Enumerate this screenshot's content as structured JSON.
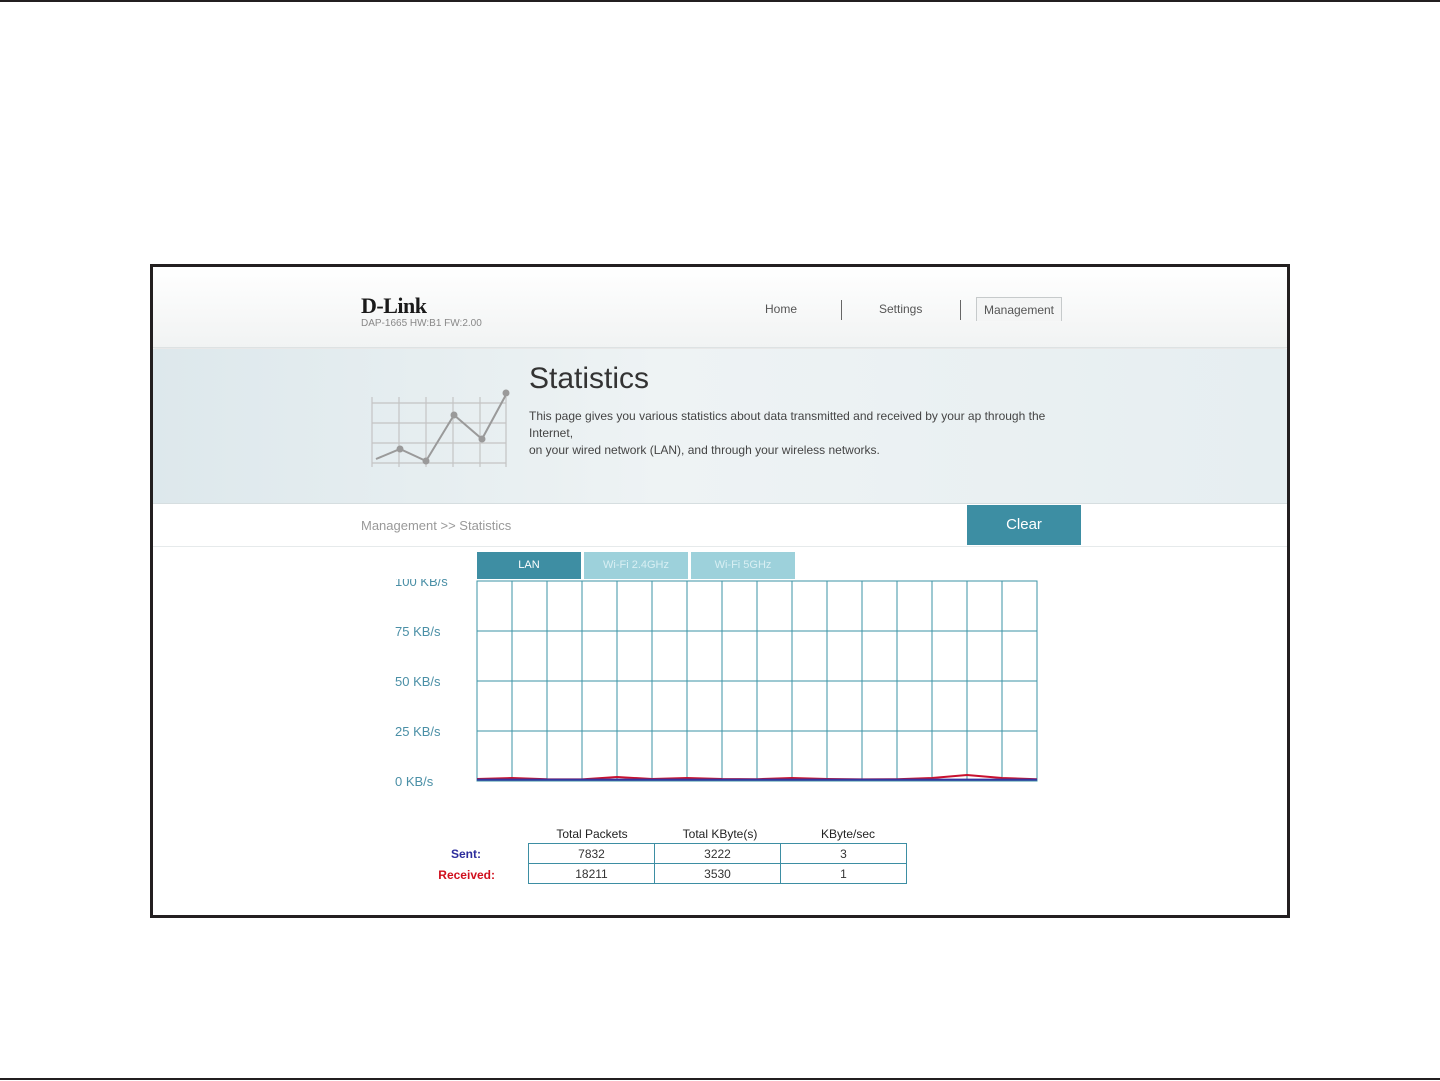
{
  "header": {
    "logo": "D-Link",
    "device_info": "DAP-1665 HW:B1 FW:2.00",
    "nav": [
      {
        "label": "Home"
      },
      {
        "label": "Settings"
      },
      {
        "label": "Management"
      }
    ]
  },
  "banner": {
    "title": "Statistics",
    "description_line1": "This page gives you various statistics about data transmitted and received by your ap through the Internet,",
    "description_line2": "on your wired network (LAN), and through your wireless networks."
  },
  "breadcrumb": "Management >> Statistics",
  "clear_button": "Clear",
  "tabs": [
    {
      "label": "LAN",
      "active": true
    },
    {
      "label": "Wi-Fi 2.4GHz",
      "active": false
    },
    {
      "label": "Wi-Fi 5GHz",
      "active": false
    }
  ],
  "chart_data": {
    "type": "line",
    "y_tick_labels": [
      "100 KB/s",
      "75 KB/s",
      "50 KB/s",
      "25 KB/s",
      "0 KB/s"
    ],
    "ylim": [
      0,
      100
    ],
    "grid": true,
    "series": [
      {
        "color": "#c8102e",
        "values": [
          0.5,
          1.0,
          0.4,
          0.3,
          1.5,
          0.5,
          1.0,
          0.5,
          0.4,
          1.0,
          0.5,
          0.3,
          0.4,
          1.0,
          2.5,
          1.0,
          0.4
        ]
      },
      {
        "color": "#3535a0",
        "values": [
          0.2,
          0.2,
          0.2,
          0.2,
          0.2,
          0.2,
          0.2,
          0.2,
          0.2,
          0.2,
          0.2,
          0.2,
          0.2,
          0.2,
          0.2,
          0.2,
          0.2
        ]
      }
    ]
  },
  "stats": {
    "columns": [
      "Total Packets",
      "Total KByte(s)",
      "KByte/sec"
    ],
    "rows": [
      {
        "label": "Sent:",
        "color": "#2d2d9c",
        "values": [
          "7832",
          "3222",
          "3"
        ]
      },
      {
        "label": "Received:",
        "color": "#d0101e",
        "values": [
          "18211",
          "3530",
          "1"
        ]
      }
    ]
  },
  "colors": {
    "accent": "#3d8ea3",
    "tab_inactive": "#9dd1db",
    "grid": "#3b93a6"
  }
}
